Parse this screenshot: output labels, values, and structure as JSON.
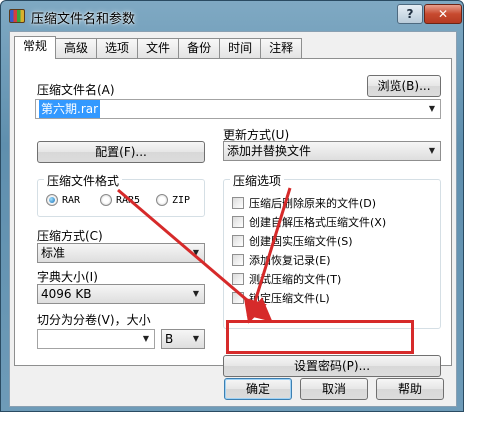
{
  "window": {
    "title": "压缩文件名和参数",
    "help_label": "?",
    "close_label": "✕"
  },
  "tabs": [
    {
      "label": "常规",
      "active": true
    },
    {
      "label": "高级"
    },
    {
      "label": "选项"
    },
    {
      "label": "文件"
    },
    {
      "label": "备份"
    },
    {
      "label": "时间"
    },
    {
      "label": "注释"
    }
  ],
  "archive": {
    "name_label": "压缩文件名(A)",
    "browse_label": "浏览(B)...",
    "name_value": "第六期.rar"
  },
  "config_button": "配置(F)...",
  "update": {
    "label": "更新方式(U)",
    "value": "添加并替换文件"
  },
  "format": {
    "legend": "压缩文件格式",
    "options": [
      {
        "label": "RAR",
        "selected": true
      },
      {
        "label": "RAR5",
        "selected": false
      },
      {
        "label": "ZIP",
        "selected": false
      }
    ]
  },
  "method": {
    "label": "压缩方式(C)",
    "value": "标准"
  },
  "dict": {
    "label": "字典大小(I)",
    "value": "4096 KB"
  },
  "split": {
    "label": "切分为分卷(V)，大小",
    "value": "",
    "unit": "B"
  },
  "options_group": {
    "legend": "压缩选项",
    "items": [
      {
        "label": "压缩后删除原来的文件(D)",
        "checked": false
      },
      {
        "label": "创建自解压格式压缩文件(X)",
        "checked": false
      },
      {
        "label": "创建固实压缩文件(S)",
        "checked": false
      },
      {
        "label": "添加恢复记录(E)",
        "checked": false
      },
      {
        "label": "测试压缩的文件(T)",
        "checked": false
      },
      {
        "label": "锁定压缩文件(L)",
        "checked": false
      }
    ]
  },
  "password_button": "设置密码(P)...",
  "footer": {
    "ok": "确定",
    "cancel": "取消",
    "help": "帮助"
  },
  "accent_colors": {
    "annotation_red": "#d62a2a",
    "selection_blue": "#3399ff"
  }
}
